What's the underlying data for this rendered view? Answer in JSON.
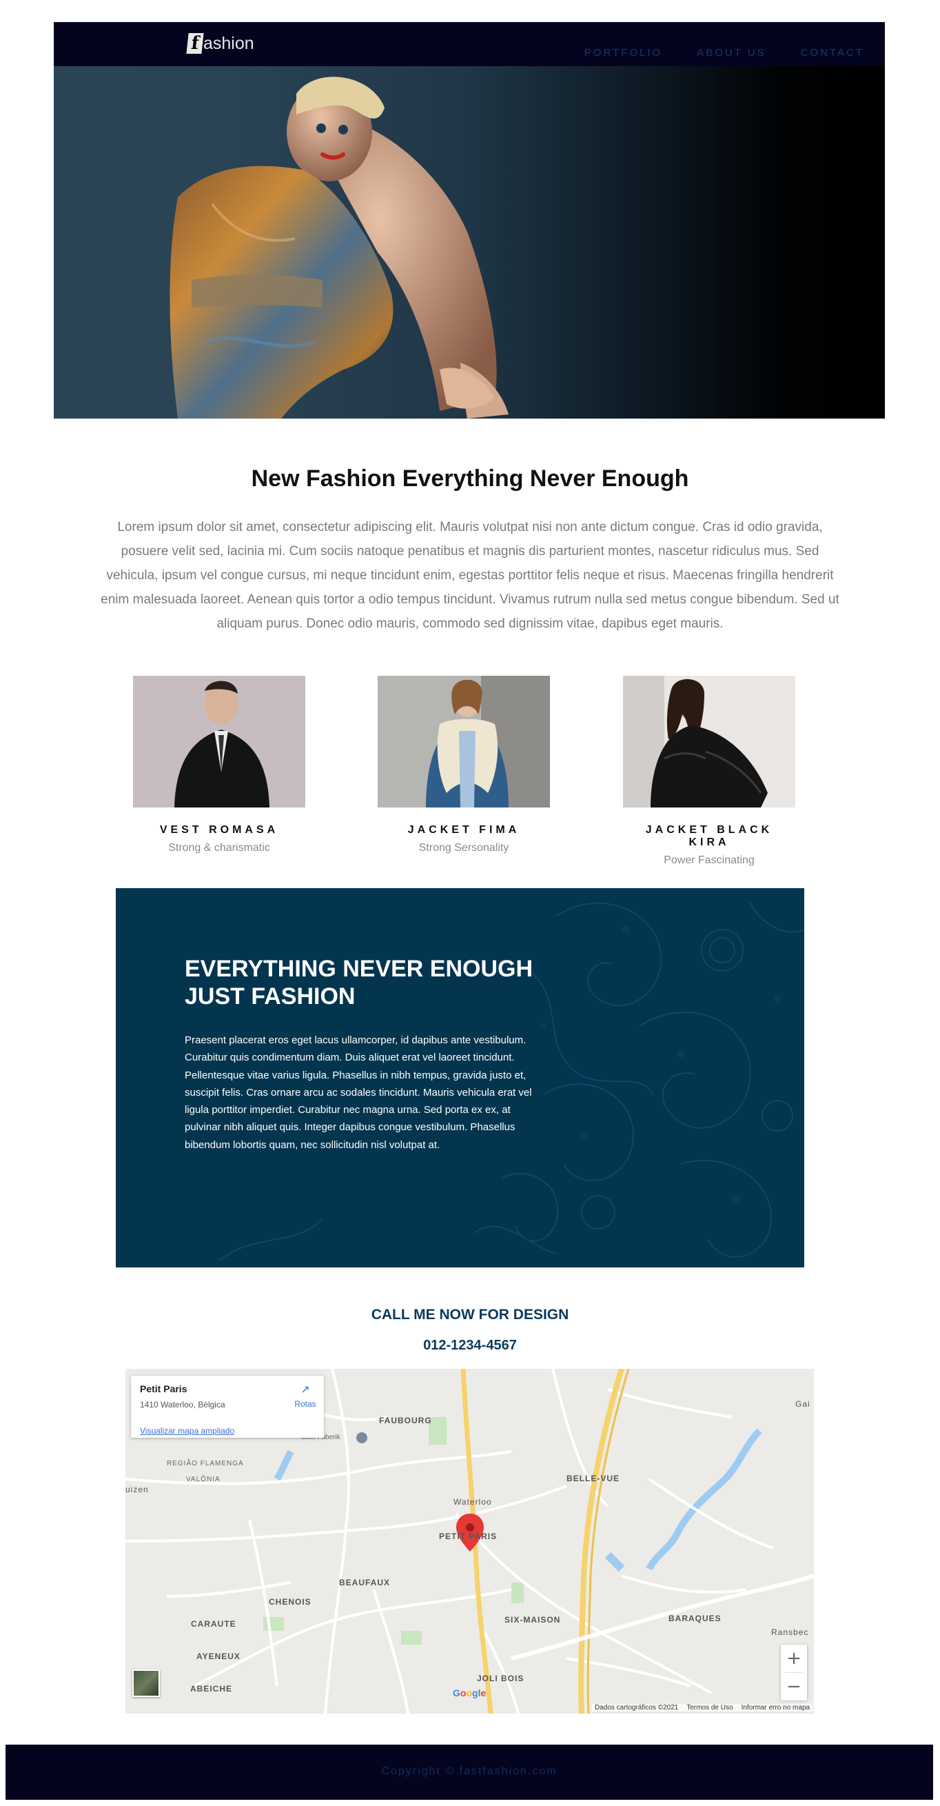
{
  "header": {
    "logo_letter": "f",
    "logo_text": "ashion",
    "nav": [
      {
        "label": "PORTFOLIO"
      },
      {
        "label": "ABOUT US"
      },
      {
        "label": "CONTACT"
      }
    ]
  },
  "intro": {
    "title": "New Fashion Everything Never Enough",
    "text": "Lorem ipsum dolor sit amet, consectetur adipiscing elit. Mauris volutpat nisi non ante dictum congue. Cras id odio gravida, posuere velit sed, lacinia mi. Cum sociis natoque penatibus et magnis dis parturient montes, nascetur ridiculus mus. Sed vehicula, ipsum vel congue cursus, mi neque tincidunt enim, egestas porttitor felis neque et risus. Maecenas fringilla hendrerit enim malesuada laoreet. Aenean quis tortor a odio tempus tincidunt. Vivamus rutrum nulla sed metus congue bibendum. Sed ut aliquam purus. Donec odio mauris, commodo sed dignissim vitae, dapibus eget mauris."
  },
  "products": [
    {
      "name": "VEST ROMASA",
      "subtitle": "Strong & charismatic"
    },
    {
      "name": "JACKET FIMA",
      "subtitle": "Strong Sersonality"
    },
    {
      "name": "JACKET BLACK KIRA",
      "subtitle": "Power Fascinating"
    }
  ],
  "banner": {
    "title_line1": "EVERYTHING NEVER ENOUGH",
    "title_line2": "JUST FASHION",
    "text": "Praesent placerat eros eget lacus ullamcorper, id dapibus ante vestibulum. Curabitur quis condimentum diam. Duis aliquet erat vel laoreet tincidunt. Pellentesque vitae varius ligula. Phasellus in nibh tempus, gravida justo et, suscipit felis. Cras ornare arcu ac sodales tincidunt. Mauris vehicula erat vel ligula porttitor imperdiet. Curabitur nec magna urna. Sed porta ex ex, at pulvinar nibh aliquet quis. Integer dapibus congue vestibulum. Phasellus bibendum lobortis quam, nec sollicitudin nisl volutpat at."
  },
  "call": {
    "title": "CALL ME NOW FOR DESIGN",
    "phone": "012-1234-4567"
  },
  "map": {
    "card_title": "Petit Paris",
    "card_address": "1410 Waterloo, Bélgica",
    "card_link": "Visualizar mapa ampliado",
    "directions_label": "Rotas",
    "labels": {
      "faubourg": "FAUBOURG",
      "belle_vue": "BELLE-VUE",
      "waterloo": "Waterloo",
      "petit_paris": "PETIT PARIS",
      "region_flamenga": "REGIÃO FLAMENGA",
      "valonia": "VALÔNIA",
      "beaufaux": "BEAUFAUX",
      "chenois": "CHENOIS",
      "six_maison": "SIX-MAISON",
      "baraques": "BARAQUES",
      "caraute": "CARAUTE",
      "ayeneux": "AYENEUX",
      "joli_bois": "JOLI BOIS",
      "abeiche": "ABEICHE",
      "ransbeck": "Ransbec",
      "gai": "Gai",
      "uizen": "uizen",
      "stoh_faberik": "Stoh Faberik"
    },
    "zoom_in": "+",
    "zoom_out": "−",
    "google": "Google",
    "attribution": [
      "Dados cartográficos ©2021",
      "Termos de Uso",
      "Informar erro no mapa"
    ],
    "colors": {
      "road_major": "#f6d26b",
      "road": "#ffffff",
      "water": "#9ecbf2",
      "park": "#c8e6c0",
      "pin": "#e53935"
    }
  },
  "footer": {
    "text": "Copyright © fastfashion.com"
  },
  "icons": [
    "directions-icon",
    "map-pin-icon",
    "zoom-in-icon",
    "zoom-out-icon"
  ]
}
